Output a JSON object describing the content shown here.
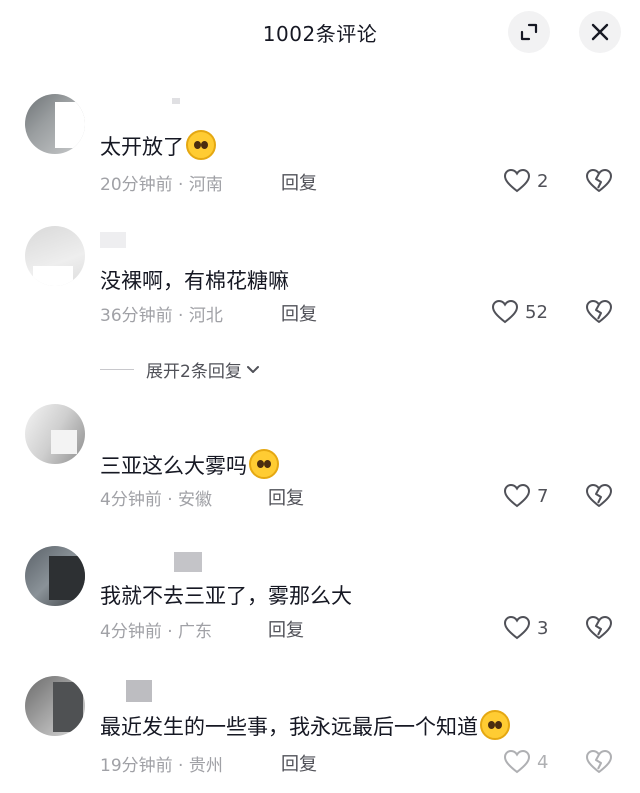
{
  "header": {
    "title": "1002条评论",
    "expand_icon": "expand-corners-icon",
    "close_icon": "close-icon"
  },
  "comments": [
    {
      "text": "太开放了",
      "emoji": "pleading-face-emoji",
      "meta": "20分钟前 · 河南",
      "reply": "回复",
      "likes": "2"
    },
    {
      "text": "没裸啊，有棉花糖嘛",
      "emoji": "",
      "meta": "36分钟前 · 河北",
      "reply": "回复",
      "likes": "52",
      "expand": "展开2条回复"
    },
    {
      "text": "三亚这么大雾吗",
      "emoji": "flushed-face-emoji",
      "meta": "4分钟前 · 安徽",
      "reply": "回复",
      "likes": "7"
    },
    {
      "text": "我就不去三亚了，雾那么大",
      "emoji": "",
      "meta": "4分钟前 · 广东",
      "reply": "回复",
      "likes": "3"
    },
    {
      "text": "最近发生的一些事，我永远最后一个知道",
      "emoji": "crying-face-emoji",
      "meta": "19分钟前 · 贵州",
      "reply": "回复",
      "likes": "4"
    }
  ],
  "colors": {
    "text_primary": "#161823",
    "text_secondary": "#a0a1a6",
    "icon_bg": "#f2f2f3"
  }
}
